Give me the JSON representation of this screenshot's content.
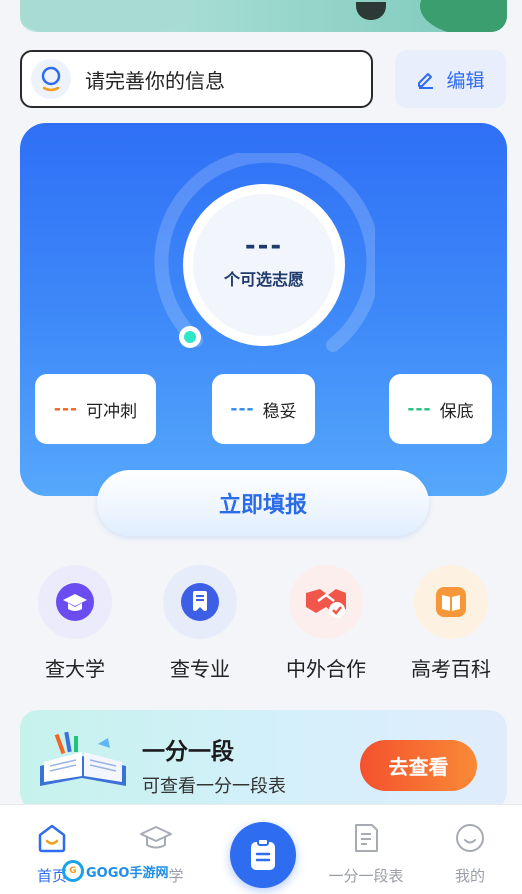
{
  "profile": {
    "prompt": "请完善你的信息",
    "edit_label": "编辑"
  },
  "summary": {
    "count": "---",
    "count_label": "个可选志愿",
    "progress": 0,
    "stats": [
      {
        "value": "---",
        "label": "可冲刺",
        "color": "#f26522"
      },
      {
        "value": "---",
        "label": "稳妥",
        "color": "#2e8bf0"
      },
      {
        "value": "---",
        "label": "保底",
        "color": "#1fc37a"
      }
    ],
    "fill_button": "立即填报"
  },
  "quick_entries": [
    {
      "label": "查大学",
      "icon": "graduation-cap-icon"
    },
    {
      "label": "查专业",
      "icon": "bookmark-icon"
    },
    {
      "label": "中外合作",
      "icon": "handshake-icon"
    },
    {
      "label": "高考百科",
      "icon": "book-icon"
    }
  ],
  "ranking_card": {
    "title": "一分一段",
    "subtitle": "可查看一分一段表",
    "button": "去查看"
  },
  "tabbar": {
    "items": [
      {
        "label": "首页",
        "icon": "home-icon",
        "active": true
      },
      {
        "label": "学",
        "icon": "graduation-cap-icon",
        "active": false
      },
      {
        "label": "",
        "icon": "clipboard-icon",
        "active": false
      },
      {
        "label": "一分一段表",
        "icon": "document-icon",
        "active": false
      },
      {
        "label": "我的",
        "icon": "smile-icon",
        "active": false
      }
    ]
  },
  "watermark": {
    "text": "GOGO手游网"
  },
  "colors": {
    "accent": "#2e6cf0",
    "card_top": "#2f6ff6",
    "card_bottom": "#56a8fb",
    "cta_orange": "#f4512e"
  }
}
